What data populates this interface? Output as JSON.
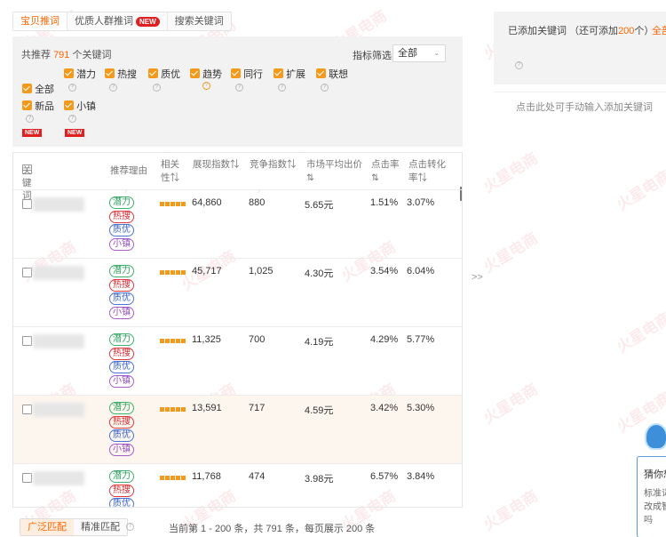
{
  "tabs": {
    "items": [
      "宝贝推词",
      "优质人群推词",
      "搜索关键词"
    ],
    "new_badge": "NEW"
  },
  "filter": {
    "total_prefix": "共推荐",
    "total_count": "791",
    "total_suffix": "个关键词",
    "metric_label": "指标筛选",
    "metric_value": "全部",
    "options": {
      "all": "全部",
      "potential": "潜力",
      "hot": "热搜",
      "quality": "质优",
      "trend": "趋势",
      "peer": "同行",
      "expand": "扩展",
      "associate": "联想",
      "new": "新品",
      "small": "小镇"
    },
    "new_badge": "NEW"
  },
  "table": {
    "headers": {
      "keyword": "关键词",
      "reason": "推荐理由",
      "relevance_1": "相关",
      "relevance_2": "性⇅",
      "impressions": "展现指数⇅",
      "competition": "竞争指数⇅",
      "avg_bid_1": "市场平均出价",
      "avg_bid_2": "⇅",
      "ctr_1": "点击率",
      "ctr_2": "⇅",
      "cvr_1": "点击转化",
      "cvr_2": "率⇅"
    },
    "tag_labels": {
      "potential": "潜力",
      "hot": "热搜",
      "quality": "质优",
      "small": "小镇"
    },
    "rows": [
      {
        "impressions": "64,860",
        "competition": "880",
        "avg_bid": "5.65元",
        "ctr": "1.51%",
        "cvr": "3.07%",
        "relevance": 5
      },
      {
        "impressions": "45,717",
        "competition": "1,025",
        "avg_bid": "4.30元",
        "ctr": "3.54%",
        "cvr": "6.04%",
        "relevance": 5
      },
      {
        "impressions": "11,325",
        "competition": "700",
        "avg_bid": "4.19元",
        "ctr": "4.29%",
        "cvr": "5.77%",
        "relevance": 5
      },
      {
        "impressions": "13,591",
        "competition": "717",
        "avg_bid": "4.59元",
        "ctr": "3.42%",
        "cvr": "5.30%",
        "relevance": 5
      },
      {
        "impressions": "11,768",
        "competition": "474",
        "avg_bid": "3.98元",
        "ctr": "6.57%",
        "cvr": "3.84%",
        "relevance": 5
      }
    ]
  },
  "match": {
    "broad": "广泛匹配",
    "exact": "精准匹配"
  },
  "pager": "当前第 1 - 200 条，共 791 条，每页展示 200 条",
  "right": {
    "added_prefix": "已添加关键词 （还可添加",
    "added_remaining": "200",
    "added_suffix": "个）",
    "add_all": "全部",
    "manual_hint": "点击此处可手动输入添加关键词",
    "arrow": ">>"
  },
  "chat": {
    "title": "猜你想",
    "body": "标准词改成智吗"
  },
  "watermark": "火星电商",
  "colors": {
    "accent": "#ff6600",
    "checkbox": "#f39a1c",
    "badge": "#e02020"
  }
}
